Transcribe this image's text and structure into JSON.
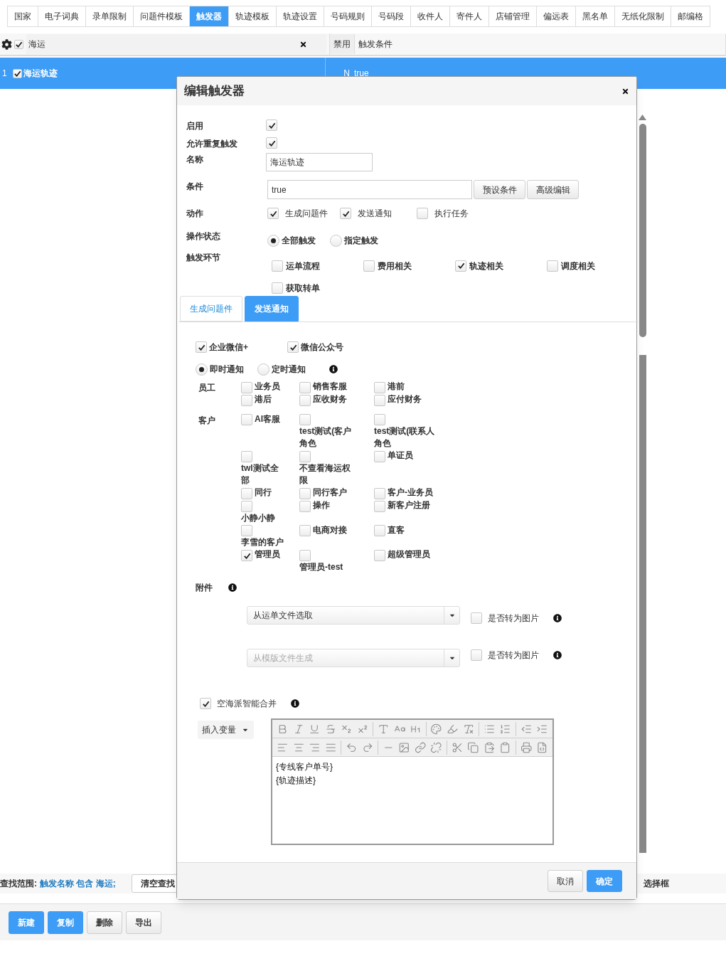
{
  "tabs": [
    {
      "label": "国家",
      "selected": false
    },
    {
      "label": "电子词典",
      "selected": false
    },
    {
      "label": "录单限制",
      "selected": false
    },
    {
      "label": "问题件模板",
      "selected": false
    },
    {
      "label": "触发器",
      "selected": true
    },
    {
      "label": "轨迹模板",
      "selected": false
    },
    {
      "label": "轨迹设置",
      "selected": false
    },
    {
      "label": "号码规则",
      "selected": false
    },
    {
      "label": "号码段",
      "selected": false
    },
    {
      "label": "收件人",
      "selected": false
    },
    {
      "label": "寄件人",
      "selected": false
    },
    {
      "label": "店铺管理",
      "selected": false
    },
    {
      "label": "偏远表",
      "selected": false
    },
    {
      "label": "黑名单",
      "selected": false
    },
    {
      "label": "无纸化限制",
      "selected": false
    },
    {
      "label": "邮编格",
      "selected": false
    }
  ],
  "grid": {
    "header_checked": true,
    "filter": {
      "value": "海运"
    },
    "columns": [
      "禁用",
      "触发条件"
    ],
    "rows": [
      {
        "number": "1",
        "checked": true,
        "name": "海运轨迹",
        "disabled": "N",
        "condition": "true",
        "selected": true
      }
    ]
  },
  "search_bar": {
    "label": "查找范围:",
    "value": "触发名称 包含 海运;",
    "clear_button": "清空查找",
    "trailing_text": "选择框"
  },
  "toolbar": [
    {
      "label": "新建",
      "kind": "primary"
    },
    {
      "label": "复制",
      "kind": "primary"
    },
    {
      "label": "删除",
      "kind": "default"
    },
    {
      "label": "导出",
      "kind": "default"
    }
  ],
  "dialog": {
    "title": "编辑触发器",
    "enabled": {
      "label": "启用",
      "checked": true
    },
    "allow_repeat": {
      "label": "允许重复触发",
      "checked": true
    },
    "name": {
      "label": "名称",
      "value": "海运轨迹"
    },
    "condition": {
      "label": "条件",
      "value": "true",
      "buttons": [
        "预设条件",
        "高级编辑"
      ]
    },
    "actions": {
      "label": "动作",
      "options": [
        {
          "label": "生成问题件",
          "checked": true
        },
        {
          "label": "发送通知",
          "checked": true
        },
        {
          "label": "执行任务",
          "checked": false
        }
      ]
    },
    "operation_state": {
      "label": "操作状态",
      "options": [
        {
          "label": "全部触发",
          "selected": true
        },
        {
          "label": "指定触发",
          "selected": false
        }
      ]
    },
    "trigger_stages": {
      "label": "触发环节",
      "options": [
        {
          "label": "运单流程",
          "checked": false
        },
        {
          "label": "费用相关",
          "checked": false
        },
        {
          "label": "轨迹相关",
          "checked": true
        },
        {
          "label": "调度相关",
          "checked": false
        },
        {
          "label": "获取转单",
          "checked": false
        }
      ]
    },
    "tabs": [
      {
        "label": "生成问题件",
        "selected": false
      },
      {
        "label": "发送通知",
        "selected": true
      }
    ],
    "notify": {
      "channels": [
        {
          "label": "企业微信+",
          "checked": true
        },
        {
          "label": "微信公众号",
          "checked": true
        }
      ],
      "timing": [
        {
          "label": "即时通知",
          "selected": true
        },
        {
          "label": "定时通知",
          "selected": false
        }
      ],
      "recipient_groups": [
        {
          "label": "员工",
          "options": [
            {
              "label": "业务员",
              "checked": false
            },
            {
              "label": "销售客服",
              "checked": false
            },
            {
              "label": "港前",
              "checked": false
            },
            {
              "label": "港后",
              "checked": false
            },
            {
              "label": "应收财务",
              "checked": false
            },
            {
              "label": "应付财务",
              "checked": false
            }
          ]
        },
        {
          "label": "客户",
          "options": [
            {
              "label": "AI客服",
              "checked": false
            },
            {
              "label": "test测试(客户角色",
              "checked": false
            },
            {
              "label": "test测试(联系人角色",
              "checked": false
            },
            {
              "label": "twl测试全部",
              "checked": false
            },
            {
              "label": "不查看海运权限",
              "checked": false
            },
            {
              "label": "单证员",
              "checked": false
            },
            {
              "label": "同行",
              "checked": false
            },
            {
              "label": "同行客户",
              "checked": false
            },
            {
              "label": "客户-业务员",
              "checked": false
            },
            {
              "label": "小静小静",
              "checked": false
            },
            {
              "label": "操作",
              "checked": false
            },
            {
              "label": "新客户注册",
              "checked": false
            },
            {
              "label": "李雪的客户",
              "checked": false
            },
            {
              "label": "电商对接",
              "checked": false
            },
            {
              "label": "直客",
              "checked": false
            },
            {
              "label": "管理员",
              "checked": true
            },
            {
              "label": "管理员-test",
              "checked": false
            },
            {
              "label": "超级管理员",
              "checked": false
            }
          ]
        }
      ],
      "attachment": {
        "label": "附件",
        "sources": [
          {
            "value": "从运单文件选取",
            "to_image": {
              "label": "是否转为图片",
              "checked": false
            }
          },
          {
            "placeholder": "从模版文件生成",
            "to_image": {
              "label": "是否转为图片",
              "checked": false
            }
          }
        ]
      },
      "merge": {
        "label": "空海派智能合并",
        "checked": true
      },
      "insert_variable": "插入变量",
      "editor_lines": [
        "{专线客户单号}",
        "{轨迹描述}"
      ]
    },
    "footer_buttons": [
      {
        "label": "取消",
        "kind": "default"
      },
      {
        "label": "确定",
        "kind": "primary"
      }
    ]
  }
}
